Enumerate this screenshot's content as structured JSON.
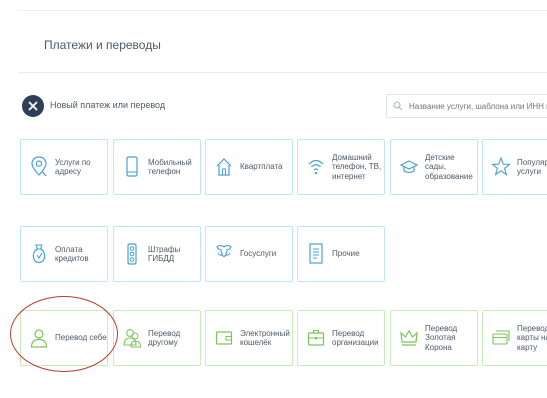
{
  "header": {
    "title": "Платежи и переводы"
  },
  "actions": {
    "new_payment_label": "Новый платеж или перевод",
    "search_placeholder": "Название услуги, шаблона или ИНН поставщика"
  },
  "rows": [
    [
      {
        "id": "services-by-address",
        "label": "Услуги по адресу",
        "icon": "location-search-icon"
      },
      {
        "id": "mobile-phone",
        "label": "Мобильный телефон",
        "icon": "mobile-phone-icon"
      },
      {
        "id": "rent",
        "label": "Квартплата",
        "icon": "house-icon"
      },
      {
        "id": "home-phone-tv-internet",
        "label": "Домашний телефон, ТВ, интернет",
        "icon": "wifi-icon"
      },
      {
        "id": "kindergarten-education",
        "label": "Детские сады, образование",
        "icon": "graduation-cap-icon"
      },
      {
        "id": "popular-services",
        "label": "Популярные услуги",
        "icon": "star-icon"
      }
    ],
    [
      {
        "id": "loan-payment",
        "label": "Оплата кредитов",
        "icon": "money-bag-icon"
      },
      {
        "id": "traffic-fines",
        "label": "Штрафы ГИБДД",
        "icon": "traffic-light-icon"
      },
      {
        "id": "gov-services",
        "label": "Госуслуги",
        "icon": "emblem-icon"
      },
      {
        "id": "other",
        "label": "Прочие",
        "icon": "document-icon"
      }
    ],
    [
      {
        "id": "transfer-self",
        "label": "Перевод себе",
        "icon": "person-icon"
      },
      {
        "id": "transfer-other",
        "label": "Перевод другому",
        "icon": "people-icon"
      },
      {
        "id": "e-wallet",
        "label": "Электронный кошелёк",
        "icon": "wallet-icon"
      },
      {
        "id": "transfer-organization",
        "label": "Перевод организации",
        "icon": "briefcase-icon"
      },
      {
        "id": "zolotaya-korona",
        "label": "Перевод Золотая Корона",
        "icon": "crown-icon"
      },
      {
        "id": "card-to-card",
        "label": "Перевод с карты на карту",
        "icon": "card-icon"
      }
    ]
  ],
  "colors": {
    "blue_tile_border": "#bfe6f8",
    "green_tile_border": "#c9edb8",
    "blue_icon": "#4a9fd8",
    "green_icon": "#7cc35a",
    "annotation_circle": "#c0392b"
  }
}
